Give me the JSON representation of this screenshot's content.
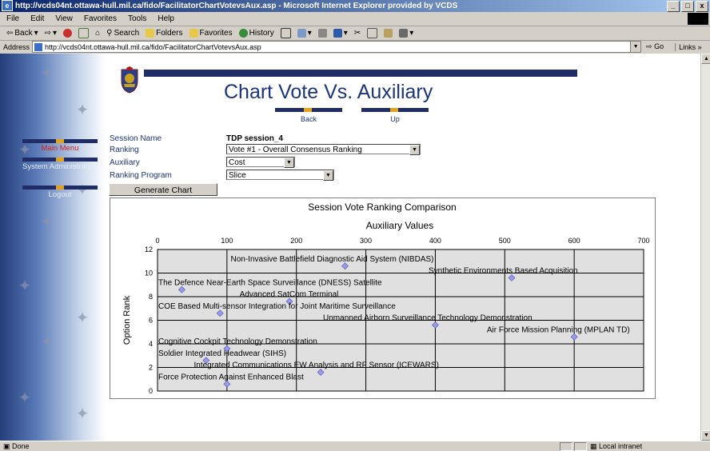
{
  "window": {
    "title": "http://vcds04nt.ottawa-hull.mil.ca/fido/FacilitatorChartVotevsAux.asp - Microsoft Internet Explorer provided by VCDS",
    "buttons": [
      "_",
      "□",
      "x"
    ]
  },
  "menu": [
    "File",
    "Edit",
    "View",
    "Favorites",
    "Tools",
    "Help"
  ],
  "toolbar": {
    "back": "Back",
    "search": "Search",
    "folders": "Folders",
    "favorites": "Favorites",
    "history": "History"
  },
  "address": {
    "label": "Address",
    "url": "http://vcds04nt.ottawa-hull.mil.ca/fido/FacilitatorChartVotevsAux.asp",
    "go": "Go",
    "links": "Links »"
  },
  "page": {
    "title": "Chart Vote Vs. Auxiliary",
    "nav": {
      "back": "Back",
      "up": "Up"
    }
  },
  "sidebar": {
    "items": [
      {
        "label": "Main Menu"
      },
      {
        "label": "System Administration"
      },
      {
        "label": "Logout"
      }
    ]
  },
  "form": {
    "session_label": "Session Name",
    "session_value": "TDP session_4",
    "ranking_label": "Ranking",
    "ranking_value": "Vote #1 - Overall Consensus Ranking",
    "auxiliary_label": "Auxiliary",
    "auxiliary_value": "Cost",
    "program_label": "Ranking Program",
    "program_value": "Slice",
    "generate_label": "Generate Chart"
  },
  "chart_data": {
    "type": "scatter",
    "title": "Session Vote Ranking Comparison",
    "xlabel": "Auxiliary Values",
    "ylabel": "Option Rank",
    "xlim": [
      0,
      700
    ],
    "ylim": [
      0,
      12
    ],
    "xticks": [
      0,
      100,
      200,
      300,
      400,
      500,
      600,
      700
    ],
    "yticks": [
      0,
      2,
      4,
      6,
      8,
      10,
      12
    ],
    "grid": true,
    "x_axis_position": "top",
    "marker_color": "#9999ee",
    "points": [
      {
        "label": "Non-Invasive Battlefield Diagnostic Aid System (NIBDAS)",
        "x": 270,
        "y": 11
      },
      {
        "label": "Synthetic Environments Based Acquisition",
        "x": 510,
        "y": 10
      },
      {
        "label": "The Defence Near-Earth Space Surveillance (DNESS) Satellite",
        "x": 35,
        "y": 9
      },
      {
        "label": "Advanced SatCom Terminal",
        "x": 190,
        "y": 8
      },
      {
        "label": "COE Based Multi-sensor Integration for Joint Maritime Surveillance",
        "x": 90,
        "y": 7
      },
      {
        "label": "Unmanned Airborn Surveillance Technology Demonstration",
        "x": 400,
        "y": 6
      },
      {
        "label": "Air Force Mission Planning (MPLAN TD)",
        "x": 600,
        "y": 5
      },
      {
        "label": "Cognitive Cockpit Technology Demonstration",
        "x": 100,
        "y": 4
      },
      {
        "label": "Soldier Integrated Headwear (SIHS)",
        "x": 70,
        "y": 3
      },
      {
        "label": "Integrated Communications EW Analysis and RF Sensor (ICEWARS)",
        "x": 235,
        "y": 2
      },
      {
        "label": "Force Protection Against Enhanced Blast",
        "x": 100,
        "y": 1
      }
    ]
  },
  "status": {
    "left": "Done",
    "zone": "Local intranet"
  }
}
